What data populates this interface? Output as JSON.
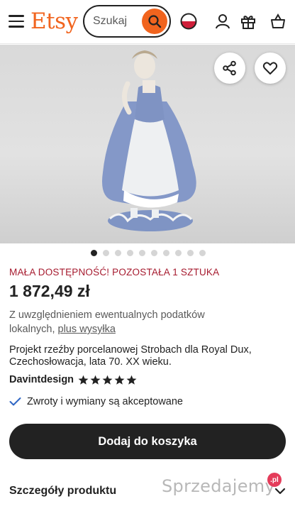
{
  "header": {
    "logo": "Etsy",
    "search_placeholder": "Szukaj",
    "icons": [
      "menu-icon",
      "search-icon",
      "flag-icon",
      "account-icon",
      "gift-icon",
      "basket-icon"
    ]
  },
  "product": {
    "image_count": 10,
    "active_image": 1,
    "urgency": "MAŁA DOSTĘPNOŚĆ! POZOSTAŁA 1 SZTUKA",
    "price": "1 872,49 zł",
    "tax_note": "Z uwzględnieniem ewentualnych podatków lokalnych,",
    "shipping_link": "plus wysyłka",
    "description": "Projekt rzeźby porcelanowej Strobach dla Royal Dux, Czechosłowacja, lata 70. XX wieku.",
    "shop_name": "Davintdesign",
    "rating_stars": 5,
    "returns": "Zwroty i wymiany są akceptowane",
    "add_to_cart": "Dodaj do koszyka",
    "details_title": "Szczegóły produktu"
  },
  "watermark": {
    "text": "Sprzedajemy",
    "badge": ".pl"
  },
  "colors": {
    "brand": "#F1641E",
    "urgency": "#A61A2E",
    "cta_bg": "#222222",
    "figurine_blue": "#7f94c4"
  }
}
